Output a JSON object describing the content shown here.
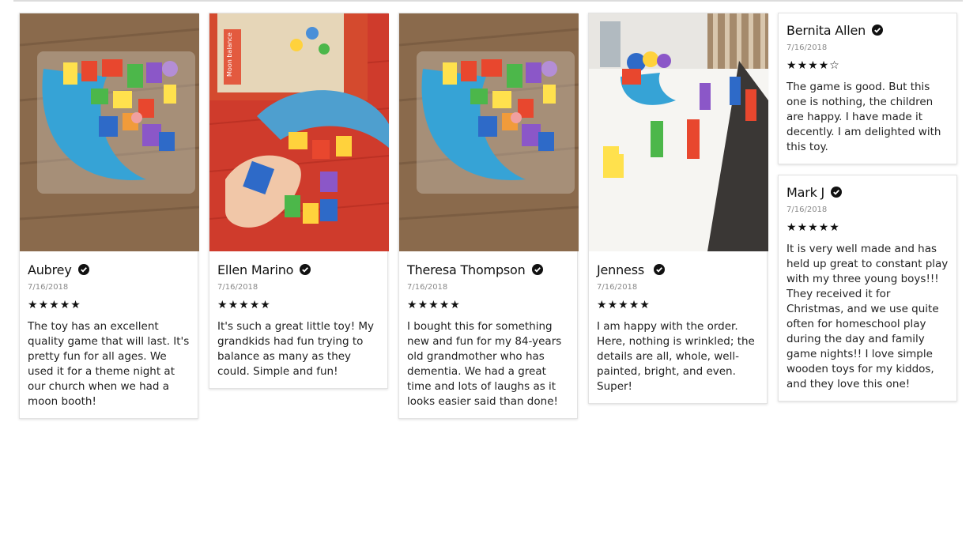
{
  "reviews": [
    {
      "name": "Aubrey",
      "date": "7/16/2018",
      "rating": 5,
      "text": "The toy has an excellent quality game that will last. It's pretty fun for all ages. We used it for a theme night at our church when we had a moon booth!"
    },
    {
      "name": "Ellen Marino",
      "date": "7/16/2018",
      "rating": 5,
      "text": "It's such a great little toy! My grandkids had fun trying to balance as many as they could. Simple and fun!"
    },
    {
      "name": "Theresa Thompson",
      "date": "7/16/2018",
      "rating": 5,
      "text": "I bought this for something new and fun for my 84-years old grandmother who has dementia. We had a great time and lots of laughs as it looks easier said than done!"
    },
    {
      "name": "Jenness",
      "date": "7/16/2018",
      "rating": 5,
      "text": "I am happy with the order. Here, nothing is wrinkled; the details are all, whole, well-painted, bright, and even. Super!"
    },
    {
      "name": "Bernita Allen",
      "date": "7/16/2018",
      "rating": 4,
      "text": "The game is good. But this one is nothing, the children are happy. I have made it decently. I am delighted with this toy."
    },
    {
      "name": "Mark J",
      "date": "7/16/2018",
      "rating": 5,
      "text": "It is very well made and has held up great to constant play with my three young boys!!! They received it for Christmas, and we use quite often for homeschool play during the day and family game nights!! I love simple wooden toys for my kiddos, and they love this one!"
    }
  ],
  "photo_box_label": "Moon balance",
  "icons": {
    "verified": "check-circle-icon",
    "star_full": "star-icon",
    "star_empty": "star-outline-icon"
  }
}
